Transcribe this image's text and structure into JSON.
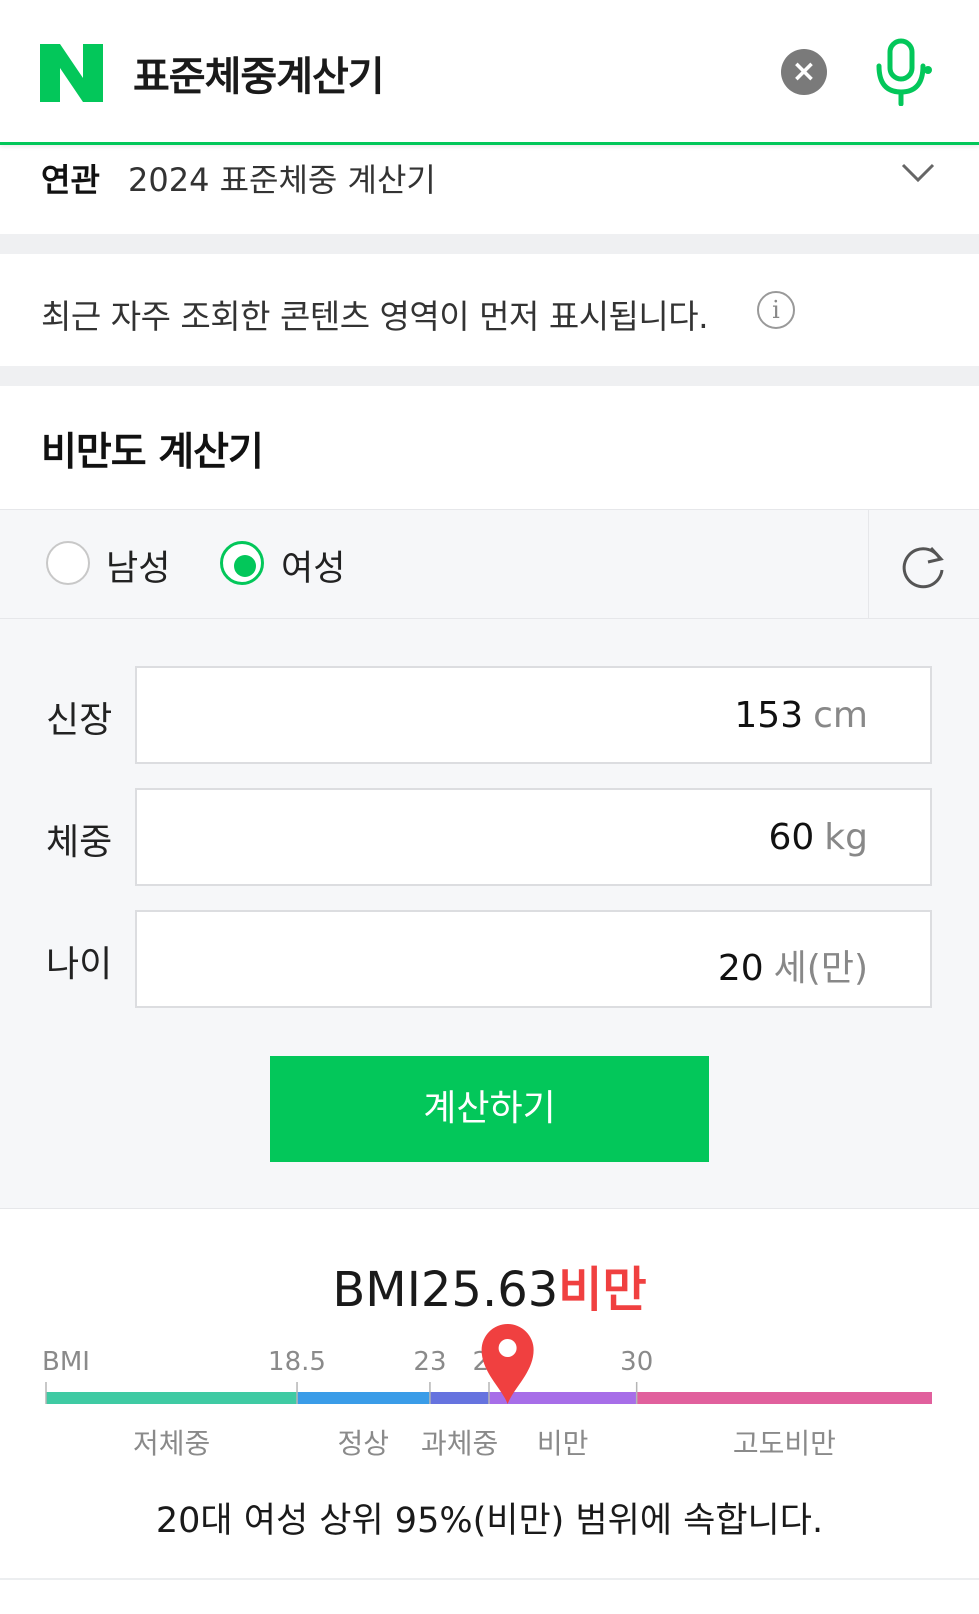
{
  "header": {
    "logo_letter": "N",
    "query": "표준체중계산기",
    "clear_icon": "close-icon",
    "mic_icon": "microphone-icon",
    "brand_color": "#03c75a"
  },
  "related": {
    "label": "연관",
    "text": "2024 표준체중 계산기"
  },
  "notice": {
    "text": "최근 자주 조회한 콘텐츠 영역이 먼저 표시됩니다."
  },
  "calculator": {
    "title": "비만도 계산기",
    "gender": {
      "options": [
        "남성",
        "여성"
      ],
      "selected": "여성"
    },
    "fields": [
      {
        "label": "신장",
        "value": "153",
        "unit": "cm"
      },
      {
        "label": "체중",
        "value": "60",
        "unit": "kg"
      },
      {
        "label": "나이",
        "value": "20",
        "unit": "세(만)"
      }
    ],
    "submit_label": "계산하기"
  },
  "result": {
    "bmi_prefix": "BMI",
    "bmi_value": "25.63",
    "status": "비만",
    "status_color": "#f04040",
    "scale": {
      "axis_label": "BMI",
      "min": 10,
      "max": 40,
      "thresholds": [
        18.5,
        23,
        25,
        30
      ],
      "threshold_labels": [
        "18.5",
        "23",
        "25",
        "30"
      ],
      "bands": [
        {
          "label": "저체중",
          "color": "#3fcaa3"
        },
        {
          "label": "정상",
          "color": "#3a9ce8"
        },
        {
          "label": "과체중",
          "color": "#6673df"
        },
        {
          "label": "비만",
          "color": "#a76ee8"
        },
        {
          "label": "고도비만",
          "color": "#e1609d"
        }
      ],
      "marker_value": 25.63
    },
    "summary": "20대 여성 상위 95%(비만) 범위에 속합니다."
  }
}
